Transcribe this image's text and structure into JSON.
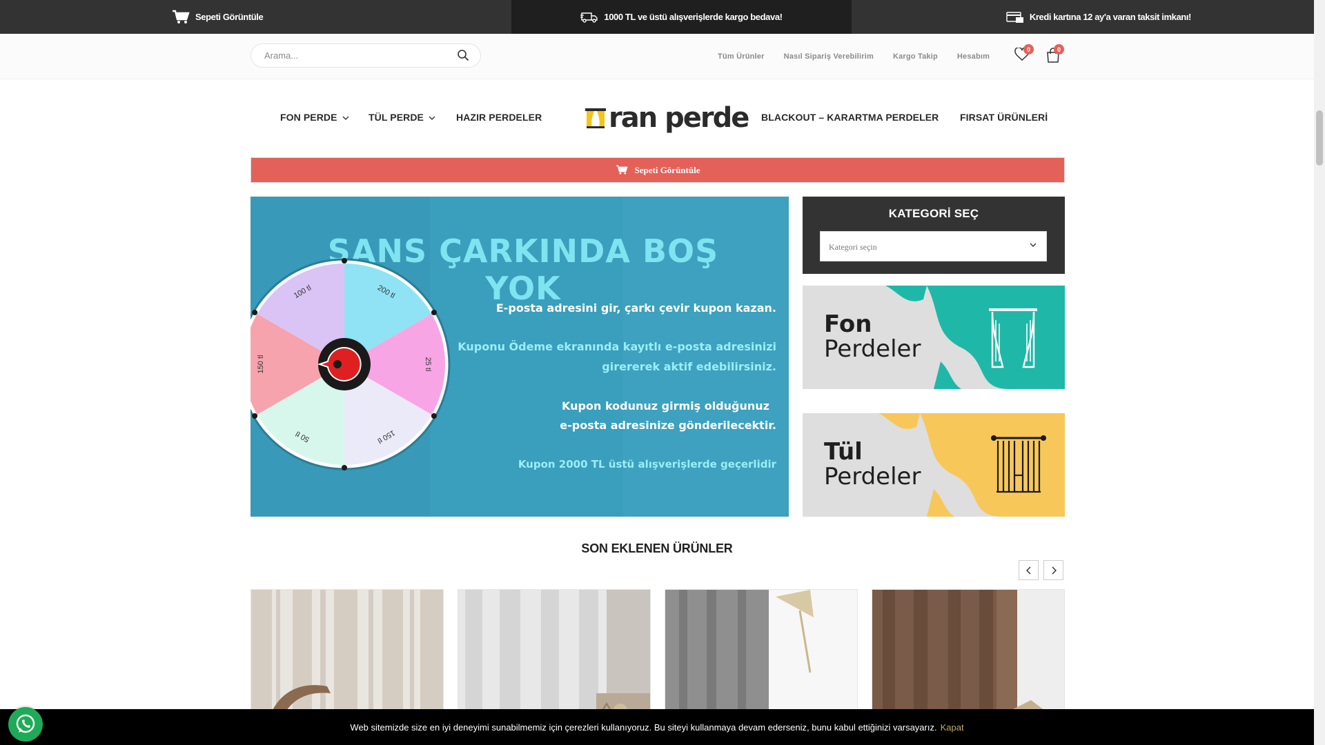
{
  "topbar": {
    "left": "Sepeti Görüntüle",
    "center": "1000 TL ve üstü alışverişlerde kargo bedava!",
    "right": "Kredi kartına 12 ay'a varan taksit imkanı!"
  },
  "search": {
    "placeholder": "Arama..."
  },
  "toplinks": [
    "Tüm Ürünler",
    "Nasıl Sipariş Verebilirim",
    "Kargo Takip",
    "Hesabım"
  ],
  "wishlist_count": "0",
  "cart_count": "0",
  "nav": {
    "fon": "FON PERDE",
    "tul": "TÜL PERDE",
    "hazir": "HAZIR PERDELER",
    "blackout": "BLACKOUT – KARARTMA PERDELER",
    "firsat": "FIRSAT ÜRÜNLERİ"
  },
  "logo": {
    "text": "ran perde"
  },
  "cartbar": {
    "label": "Sepeti Görüntüle"
  },
  "hero": {
    "headline": "ŞANS ÇARKINDA BOŞ YOK",
    "line1": "E-posta adresini gir, çarkı çevir kupon kazan.",
    "line2": "Kuponu Ödeme ekranında kayıtlı e-posta adresinizi",
    "line3": "girererek aktif edebilirsiniz.",
    "line4": "Kupon kodunuz girmiş olduğunuz",
    "line5": "e-posta adresinize gönderilecektir.",
    "line6": "Kupon 2000 TL üstü alışverişlerde geçerlidir",
    "wheel": [
      "200 tl",
      "25 tl",
      "150 tl",
      "50 tl",
      "150 tl",
      "100 tl"
    ]
  },
  "kategori": {
    "title": "KATEGORİ SEÇ",
    "select": "Kategori seçin"
  },
  "banner_fon": {
    "w1": "Fon",
    "w2": "Perdeler"
  },
  "banner_tul": {
    "w1": "Tül",
    "w2": "Perdeler"
  },
  "section": {
    "title": "SON EKLENEN ÜRÜNLER"
  },
  "cookie": {
    "text": "Web sitemizde size en iyi deneyimi sunabilmemiz için çerezleri kullanıyoruz. Bu siteyi kullanmaya devam ederseniz, bunu kabul ettiğinizi varsayarız.",
    "link": "Kapat"
  },
  "colors": {
    "accent": "#e36159",
    "dark": "#333333",
    "hero_bg": "#3a9ebd",
    "fon_teal": "#1fb8a8",
    "tul_yellow": "#f7c75a"
  }
}
